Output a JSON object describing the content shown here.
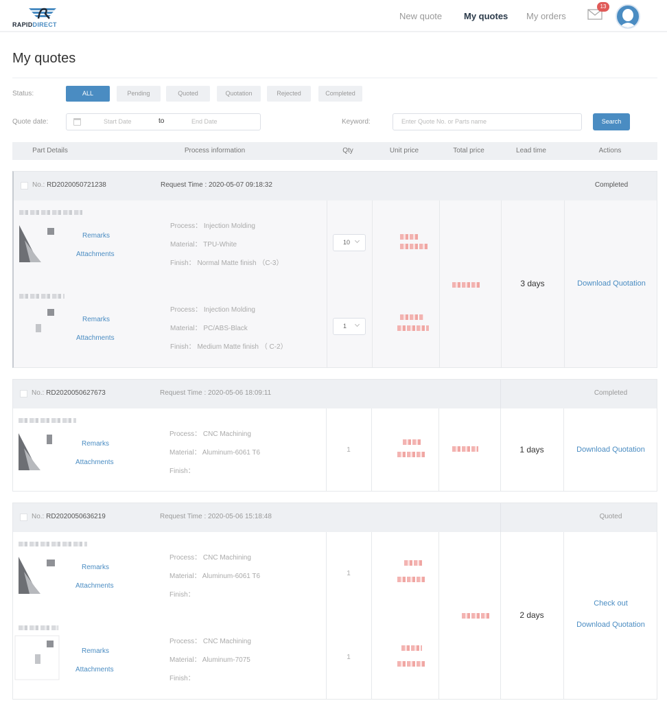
{
  "header": {
    "logo": {
      "part1": "RAPID",
      "part2": "DIRECT"
    },
    "nav": [
      {
        "label": "New quote",
        "active": false
      },
      {
        "label": "My quotes",
        "active": true
      },
      {
        "label": "My orders",
        "active": false
      }
    ],
    "notification_count": "13",
    "icons": {
      "mail": "mail-icon",
      "avatar": "user-avatar-icon"
    }
  },
  "page": {
    "title": "My quotes"
  },
  "filters": {
    "status_label": "Status:",
    "statuses": [
      "ALL",
      "Pending",
      "Quoted",
      "Quotation",
      "Rejected",
      "Completed"
    ],
    "active_status": "ALL",
    "date_label": "Quote date:",
    "start_placeholder": "Start Date",
    "to_label": "to",
    "end_placeholder": "End Date",
    "keyword_label": "Keyword:",
    "keyword_placeholder": "Enter Quote No. or Parts name",
    "search_label": "Search"
  },
  "table": {
    "columns": [
      "Part Details",
      "Process information",
      "Qty",
      "Unit price",
      "Total price",
      "Lead time",
      "Actions"
    ]
  },
  "links": {
    "remarks": "Remarks",
    "attachments": "Attachments"
  },
  "quotes": [
    {
      "no_label": "No.:",
      "no": "RD2020050721238",
      "request_time": "Request Time : 2020-05-07 09:18:32",
      "status": "Completed",
      "lead_time": "3 days",
      "actions": [
        "Download Quotation"
      ],
      "parts": [
        {
          "process": "Process： Injection Molding",
          "material": "Material： TPU-White",
          "finish": "Finish： Normal Matte finish （C-3）",
          "qty": "10",
          "qty_editable": true
        },
        {
          "process": "Process： Injection Molding",
          "material": "Material： PC/ABS-Black",
          "finish": "Finish： Medium Matte finish （ C-2）",
          "qty": "1",
          "qty_editable": true
        }
      ]
    },
    {
      "no_label": "No.:",
      "no": "RD2020050627673",
      "request_time": "Request Time : 2020-05-06 18:09:11",
      "status": "Completed",
      "lead_time": "1 days",
      "actions": [
        "Download Quotation"
      ],
      "parts": [
        {
          "process": "Process： CNC Machining",
          "material": "Material： Aluminum-6061 T6",
          "finish": "Finish：",
          "qty": "1",
          "qty_editable": false
        }
      ]
    },
    {
      "no_label": "No.:",
      "no": "RD2020050636219",
      "request_time": "Request Time : 2020-05-06 15:18:48",
      "status": "Quoted",
      "lead_time": "2 days",
      "actions": [
        "Check out",
        "Download Quotation"
      ],
      "parts": [
        {
          "process": "Process： CNC Machining",
          "material": "Material： Aluminum-6061 T6",
          "finish": "Finish：",
          "qty": "1",
          "qty_editable": false
        },
        {
          "process": "Process： CNC Machining",
          "material": "Material： Aluminum-7075",
          "finish": "Finish：",
          "qty": "1",
          "qty_editable": false
        }
      ]
    }
  ]
}
